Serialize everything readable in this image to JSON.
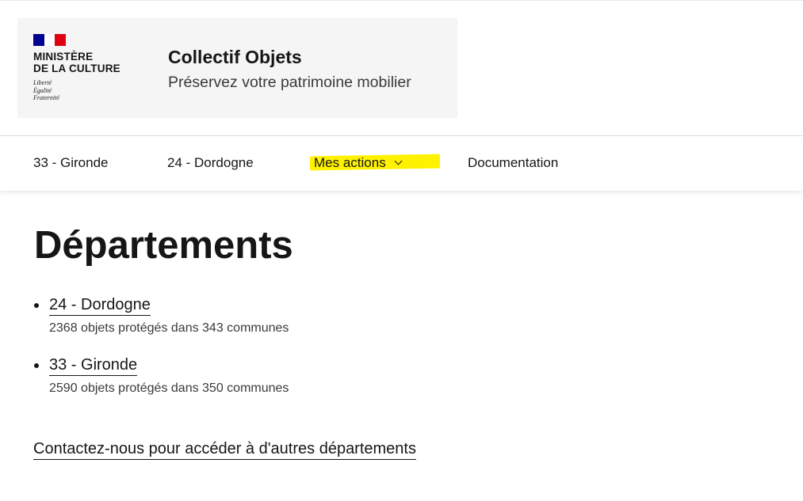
{
  "header": {
    "ministry_line1": "MINISTÈRE",
    "ministry_line2": "DE LA CULTURE",
    "devise": [
      "Liberté",
      "Égalité",
      "Fraternité"
    ],
    "site_title": "Collectif Objets",
    "site_tagline": "Préservez votre patrimoine mobilier",
    "flag_colors": [
      "#000091",
      "#ffffff",
      "#e1000f"
    ]
  },
  "nav": {
    "items": [
      {
        "label": "33 - Gironde"
      },
      {
        "label": "24 - Dordogne"
      },
      {
        "label": "Mes actions",
        "icon": "chevron-down-icon",
        "highlight": "#fff200"
      },
      {
        "label": "Documentation"
      }
    ]
  },
  "main": {
    "title": "Départements",
    "departments": [
      {
        "label": "24 - Dordogne",
        "summary": "2368 objets protégés dans 343 communes"
      },
      {
        "label": "33 - Gironde",
        "summary": "2590 objets protégés dans 350 communes"
      }
    ],
    "contact_link": "Contactez-nous pour accéder à d'autres départements"
  }
}
